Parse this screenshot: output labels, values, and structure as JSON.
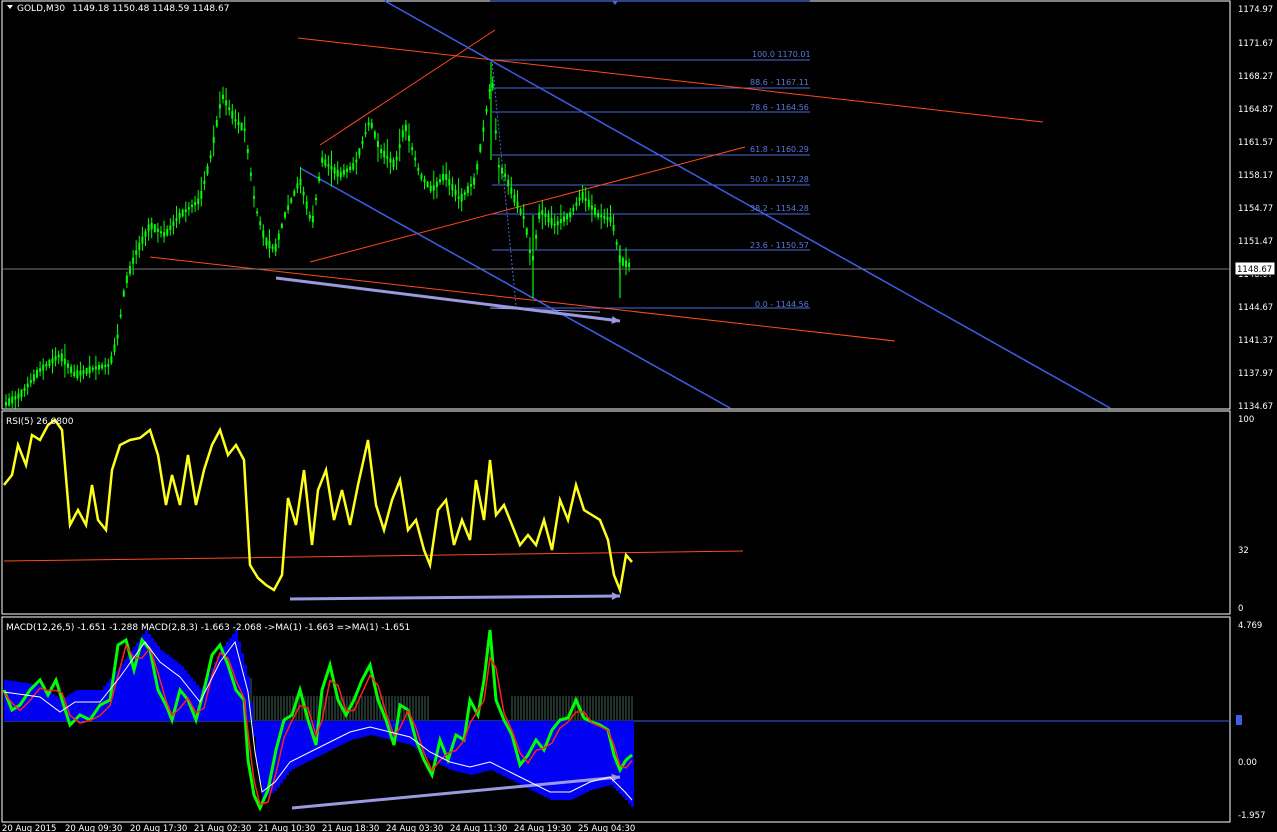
{
  "window": {
    "symbol_label": "GOLD,M30",
    "ohlc_label": "1149.18 1150.48 1148.59 1148.67"
  },
  "colors": {
    "background": "#000000",
    "grid_frame": "#ffffff",
    "candle": "#00ff00",
    "trendline": "#ff4a1c",
    "channel": "#3f5ee8",
    "fib": "#4a6ad8",
    "arrow": "#9a9ae0",
    "rsi": "#ffff1e",
    "macd_fast": "#00ff00",
    "macd_signal": "#ff2020",
    "macd_hist": "#0000ff",
    "macd_hist_dark": "#20302a"
  },
  "price_axis": {
    "labels": [
      "1174.97",
      "1171.67",
      "1168.27",
      "1164.87",
      "1161.57",
      "1158.17",
      "1154.77",
      "1151.47",
      "1148.07",
      "1144.67",
      "1141.37",
      "1137.97",
      "1134.67"
    ],
    "current_price": "1148.67"
  },
  "fibonacci": [
    {
      "label": "100.0  1170.01"
    },
    {
      "label": "88.6 - 1167.11"
    },
    {
      "label": "78.6 - 1164.56"
    },
    {
      "label": "61.8 - 1160.29"
    },
    {
      "label": "50.0 - 1157.28"
    },
    {
      "label": "38.2 - 1154.28"
    },
    {
      "label": "23.6 - 1150.57"
    },
    {
      "label": "0.0 - 1144.56"
    }
  ],
  "rsi": {
    "label": "RSI(5) 26.6800",
    "axis": [
      "100",
      "32",
      "0"
    ]
  },
  "macd": {
    "label": "MACD(12,26,5) -1.651 -1.288  MACD(2,8,3) -1.663 -2.068  ->MA(1) -1.663  =>MA(1) -1.651",
    "axis": [
      "4.769",
      "0.00",
      "-1.957"
    ]
  },
  "time_axis": [
    "20 Aug 2015",
    "20 Aug 09:30",
    "20 Aug 17:30",
    "21 Aug 02:30",
    "21 Aug 10:30",
    "21 Aug 18:30",
    "24 Aug 03:30",
    "24 Aug 11:30",
    "24 Aug 19:30",
    "25 Aug 04:30"
  ]
}
